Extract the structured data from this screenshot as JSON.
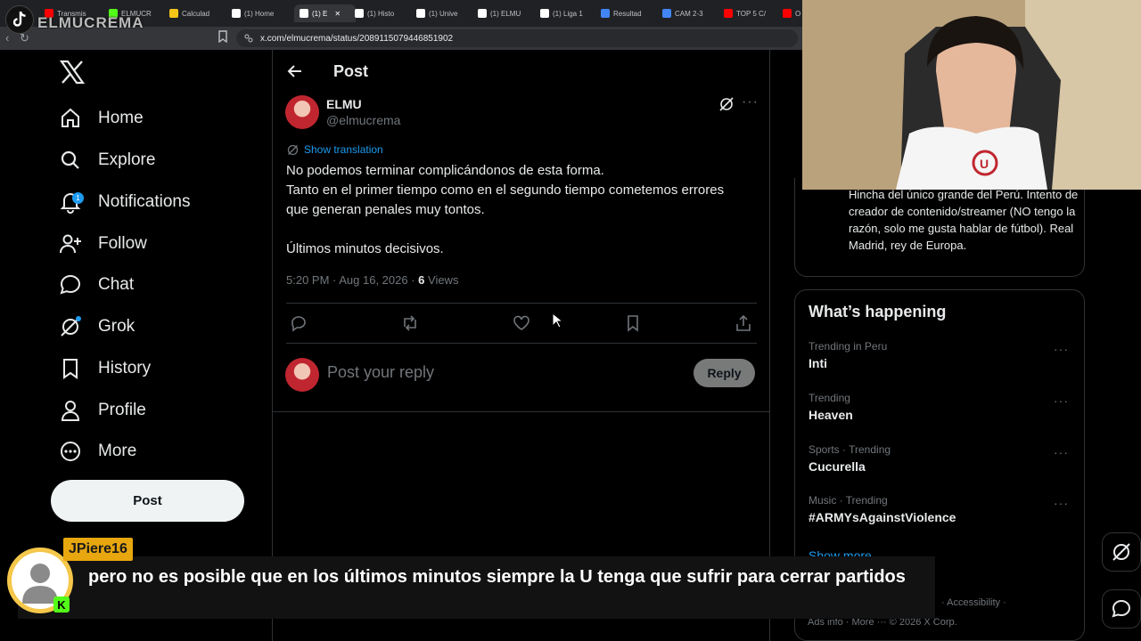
{
  "browser": {
    "tabs": [
      {
        "label": "Transmis",
        "color": "#ff0000"
      },
      {
        "label": "ELMUCR",
        "color": "#53fc18"
      },
      {
        "label": "Calculad",
        "color": "#f5c518"
      },
      {
        "label": "(1) Home",
        "color": "#ffffff"
      },
      {
        "label": "(1) E",
        "color": "#ffffff"
      },
      {
        "label": "(1) Histo",
        "color": "#ffffff"
      },
      {
        "label": "(1) Unive",
        "color": "#ffffff"
      },
      {
        "label": "(1) ELMU",
        "color": "#ffffff"
      },
      {
        "label": "(1) Liga 1",
        "color": "#ffffff"
      },
      {
        "label": "Resultad",
        "color": "#4285f4"
      },
      {
        "label": "CAM 2-3",
        "color": "#4285f4"
      },
      {
        "label": "TOP 5 C/",
        "color": "#ff0000"
      },
      {
        "label": "O",
        "color": "#ff0000"
      }
    ],
    "url": "x.com/elmucrema/status/2089115079446851902"
  },
  "overlay": {
    "stream_name": "ELMUCREMA"
  },
  "sidebar": {
    "items": [
      {
        "label": "Home",
        "icon": "home-icon"
      },
      {
        "label": "Explore",
        "icon": "search-icon"
      },
      {
        "label": "Notifications",
        "icon": "bell-icon",
        "badge": "1"
      },
      {
        "label": "Follow",
        "icon": "follow-icon"
      },
      {
        "label": "Chat",
        "icon": "chat-icon"
      },
      {
        "label": "Grok",
        "icon": "grok-icon"
      },
      {
        "label": "History",
        "icon": "bookmark-icon"
      },
      {
        "label": "Profile",
        "icon": "person-icon"
      },
      {
        "label": "More",
        "icon": "more-circle-icon"
      }
    ],
    "post_button": "Post"
  },
  "main": {
    "header_title": "Post",
    "author_name": "ELMU",
    "author_handle": "@elmucrema",
    "show_translation": "Show translation",
    "tweet_lines": [
      "No podemos terminar complicándonos de esta forma.",
      "Tanto en el primer tiempo como en el segundo tiempo cometemos errores que generan penales muy tontos.",
      "Últimos minutos decisivos."
    ],
    "timestamp": "5:20 PM · Aug 16, 2026 · ",
    "views_count": "6",
    "views_label": " Views",
    "reply_placeholder": "Post your reply",
    "reply_button": "Reply"
  },
  "right": {
    "bio_text": "Hincha del único grande del Perú. Intento de creador de contenido/streamer (NO tengo la razón, solo me gusta hablar de fútbol). Real Madrid, rey de Europa.",
    "happening_title": "What’s happening",
    "trends": [
      {
        "context": "Trending in Peru",
        "name": "Inti"
      },
      {
        "context": "Trending",
        "name": "Heaven"
      },
      {
        "context": "Sports · Trending",
        "name": "Cucurella"
      },
      {
        "context": "Music · Trending",
        "name": "#ARMYsAgainstViolence"
      }
    ],
    "show_more": "Show more",
    "footer_line1": "·      Accessibility      ·",
    "footer_line2": "Ads info  ·  More ···  © 2026 X Corp."
  },
  "chat": {
    "username": "JPiere16",
    "message": "pero no es posible que en los últimos minutos siempre la U tenga que sufrir para cerrar partidos"
  },
  "colors": {
    "accent": "#1d9bf0",
    "chat_name_bg": "#e8a60f",
    "kick_green": "#53fc18"
  }
}
